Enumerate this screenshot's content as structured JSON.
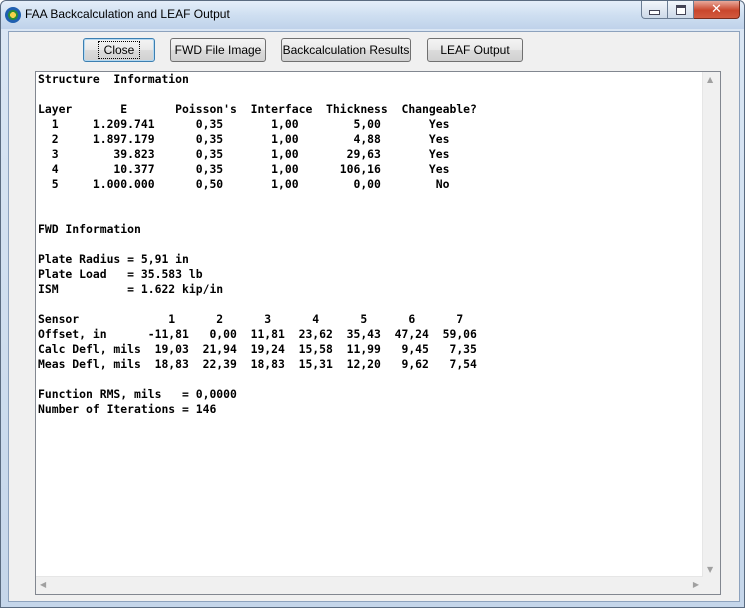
{
  "window": {
    "title": "FAA Backcalculation and LEAF Output"
  },
  "toolbar": {
    "close_label": "Close",
    "fwd_image_label": "FWD File Image",
    "backcalc_label": "Backcalculation Results",
    "leaf_label": "LEAF Output"
  },
  "output": {
    "lines": [
      "Structure  Information",
      "",
      "Layer       E       Poisson's  Interface  Thickness  Changeable?",
      "  1     1.209.741      0,35       1,00        5,00       Yes",
      "  2     1.897.179      0,35       1,00        4,88       Yes",
      "  3        39.823      0,35       1,00       29,63       Yes",
      "  4        10.377      0,35       1,00      106,16       Yes",
      "  5     1.000.000      0,50       1,00        0,00        No",
      "",
      "",
      "FWD Information",
      "",
      "Plate Radius = 5,91 in",
      "Plate Load   = 35.583 lb",
      "ISM          = 1.622 kip/in",
      "",
      "Sensor             1      2      3      4      5      6      7",
      "Offset, in      -11,81   0,00  11,81  23,62  35,43  47,24  59,06",
      "Calc Defl, mils  19,03  21,94  19,24  15,58  11,99   9,45   7,35",
      "Meas Defl, mils  18,83  22,39  18,83  15,31  12,20   9,62   7,54",
      "",
      "Function RMS, mils   = 0,0000",
      "Number of Iterations = 146"
    ]
  },
  "icons": {
    "app": "faa-globe-icon",
    "minimize": "minimize-icon",
    "maximize": "maximize-icon",
    "close": "close-icon"
  }
}
